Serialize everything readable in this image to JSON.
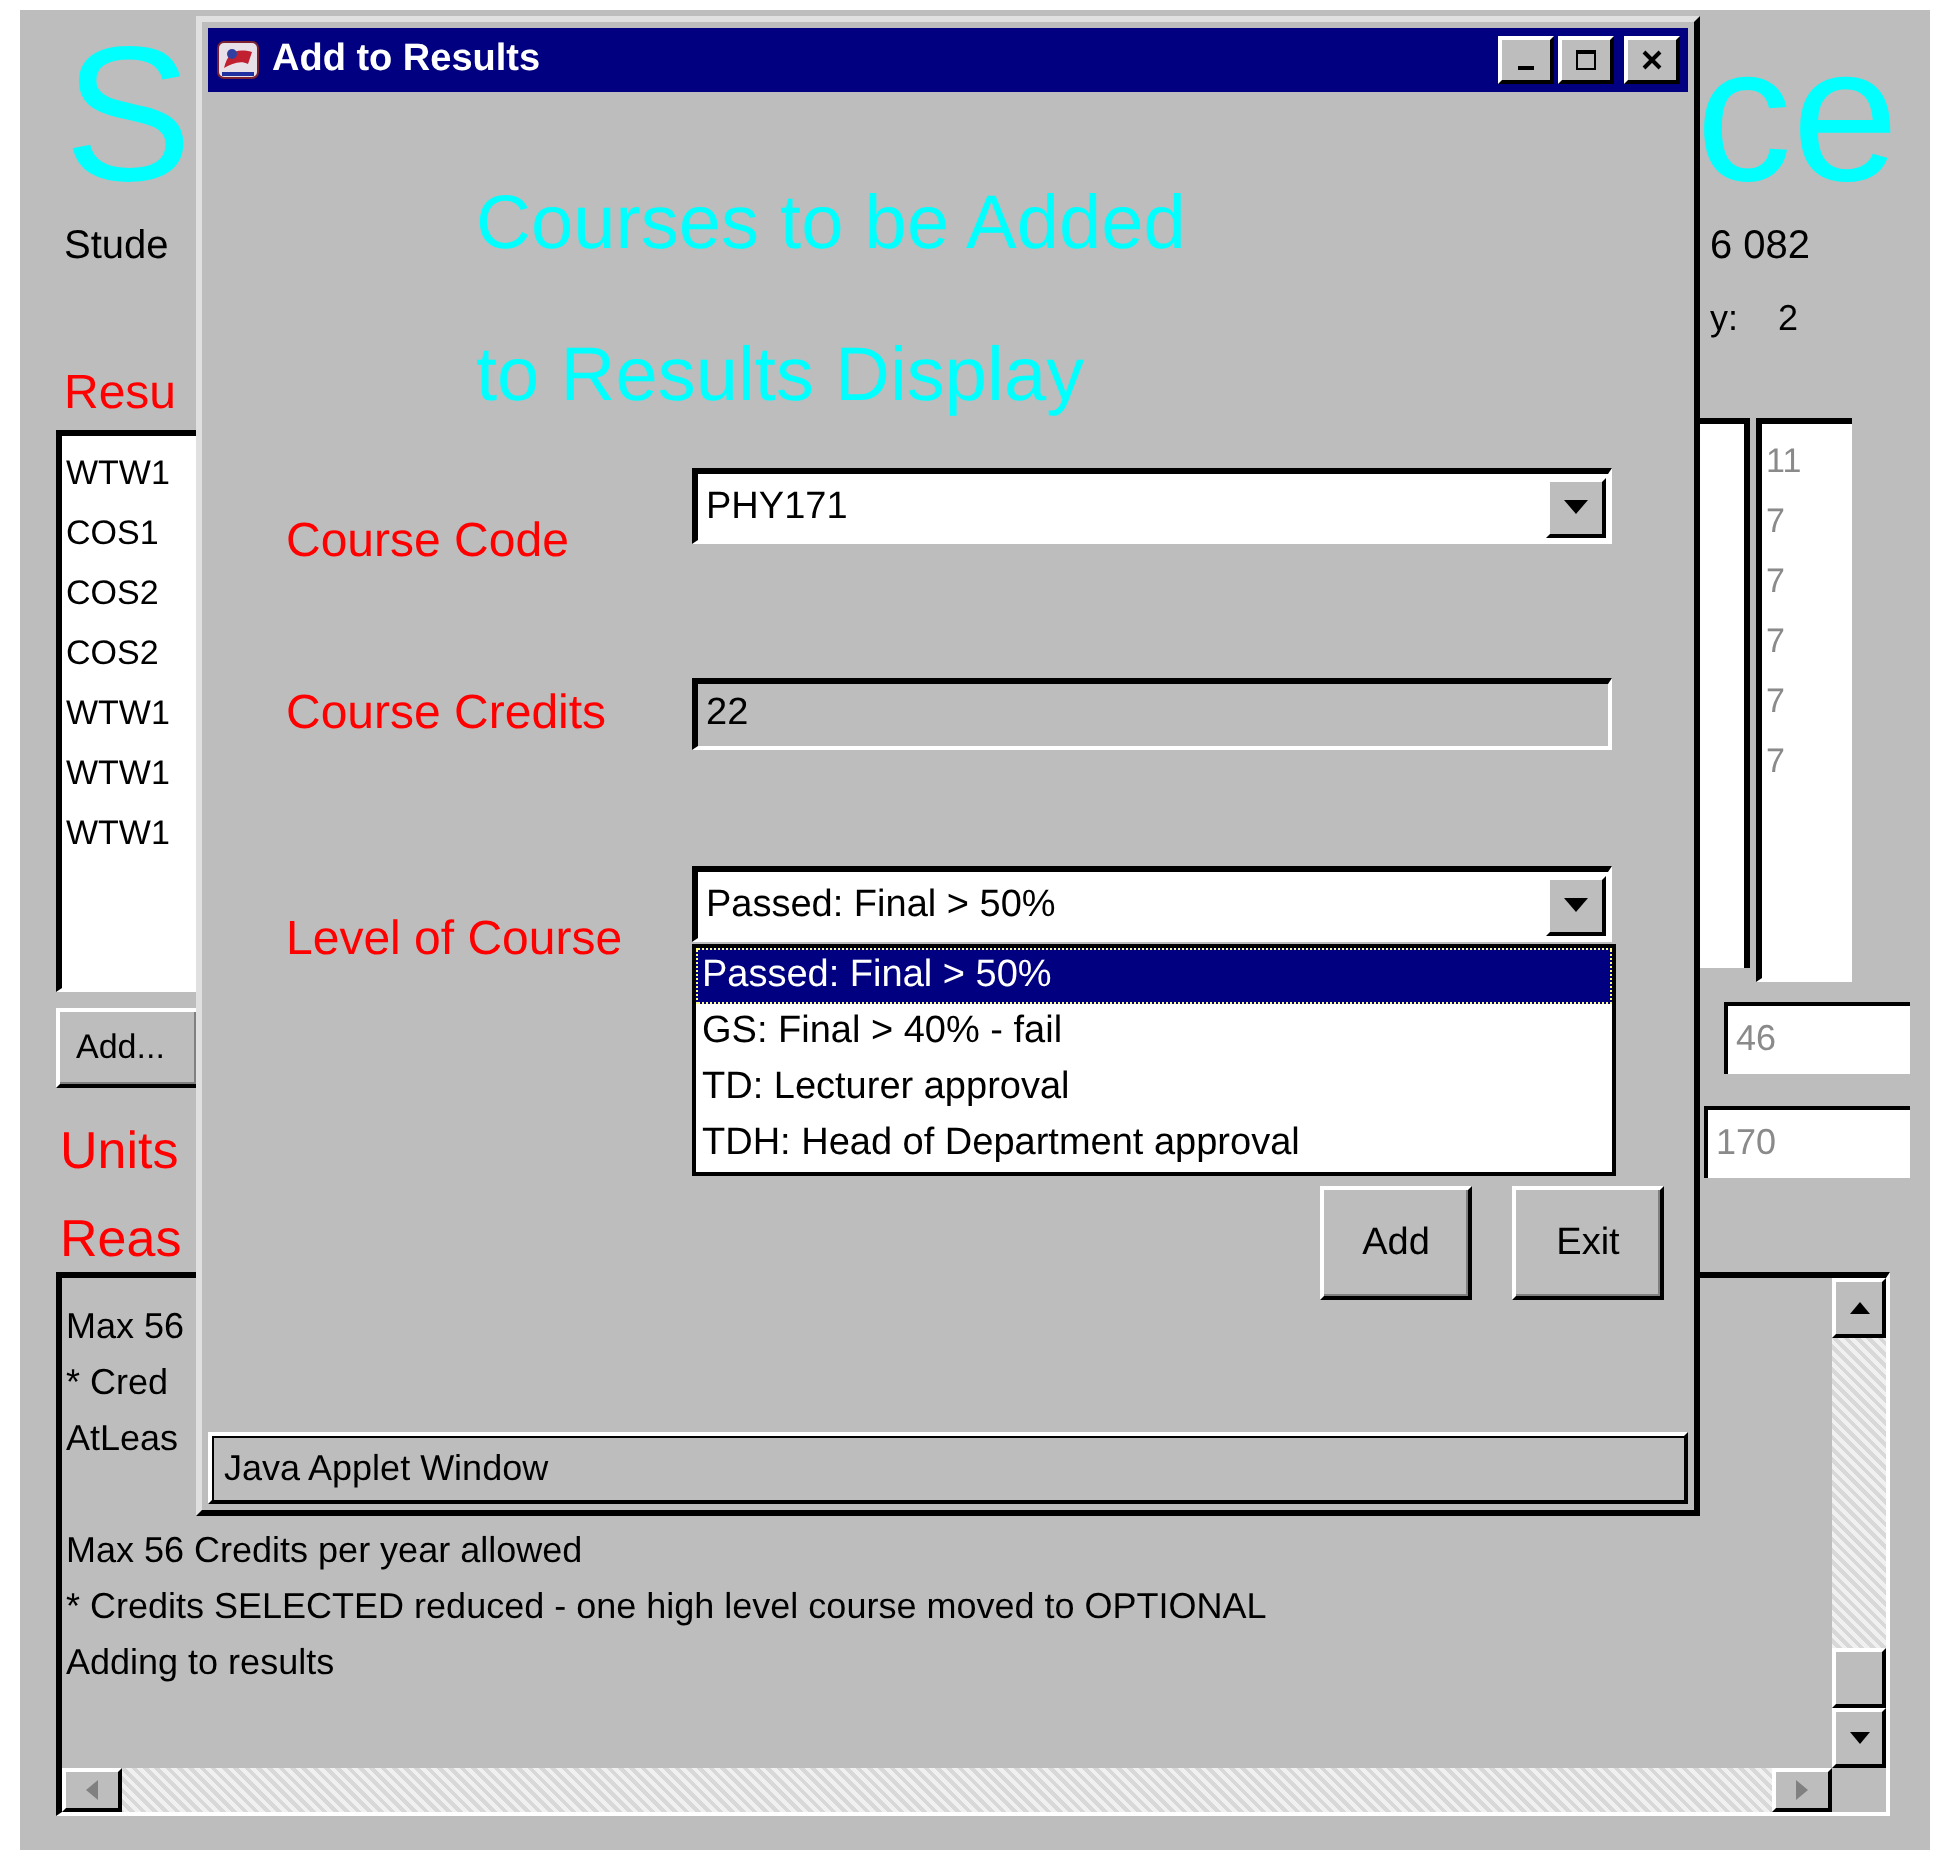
{
  "applet": {
    "title_left": "S",
    "title_right": "ce",
    "student_label": "Stude",
    "student_value": "6 082",
    "year_label": "y:",
    "year_value": "2",
    "results_label": "Resu",
    "results_list": [
      "WTW1",
      "COS1",
      "COS2",
      "COS2",
      "WTW1",
      "WTW1",
      "WTW1"
    ],
    "credits_list": [
      "11",
      "7",
      "7",
      "7",
      "7",
      "7"
    ],
    "add_button": "Add...",
    "units_label": "Units",
    "total_field": "46",
    "units_field": "170",
    "reasons_label": "Reas",
    "reasons_paragraphs": [
      [
        "Max 56",
        "* Cred",
        "AtLeas"
      ],
      [
        "Max 56 Credits per year allowed",
        "* Credits SELECTED reduced - one high level course moved to OPTIONAL",
        "Adding to results"
      ]
    ]
  },
  "dialog": {
    "title": "Add to Results",
    "heading_lines": [
      "Courses to be Added",
      "to Results Display"
    ],
    "fields": [
      {
        "kind": "combo",
        "label": "Course Code",
        "value": "PHY171"
      },
      {
        "kind": "readonly",
        "label": "Course Credits",
        "value": "22"
      },
      {
        "kind": "combo",
        "label": "Level of Course",
        "value": "Passed: Final > 50%",
        "options": [
          {
            "label": "Passed: Final > 50%",
            "selected": true
          },
          {
            "label": "GS: Final > 40% - fail",
            "selected": false
          },
          {
            "label": "TD: Lecturer approval",
            "selected": false
          },
          {
            "label": "TDH: Head of Department approval",
            "selected": false
          }
        ]
      }
    ],
    "buttons": [
      "Add",
      "Exit"
    ],
    "status": "Java Applet Window"
  }
}
